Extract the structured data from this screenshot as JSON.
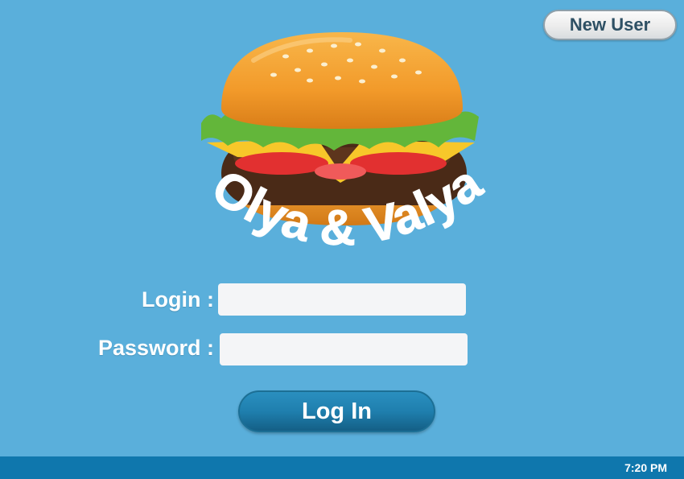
{
  "header": {
    "new_user_label": "New User"
  },
  "logo": {
    "brand_text": "Olya & Valya"
  },
  "form": {
    "login_label": "Login :",
    "login_value": "",
    "password_label": "Password :",
    "password_value": "",
    "submit_label": "Log In"
  },
  "taskbar": {
    "clock": "7:20 PM"
  },
  "colors": {
    "background": "#5aafdb",
    "taskbar": "#0f77ad",
    "button_primary": "#1f7fae",
    "button_secondary_text": "#2e5064"
  }
}
